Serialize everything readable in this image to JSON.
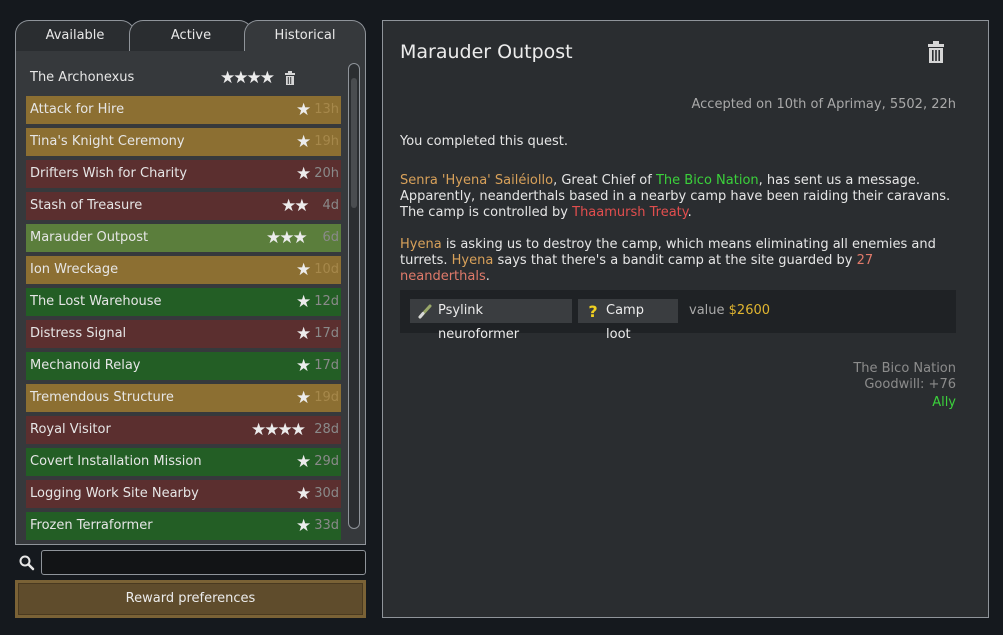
{
  "tabs": [
    {
      "label": "Available"
    },
    {
      "label": "Active"
    },
    {
      "label": "Historical"
    }
  ],
  "selected_tab": "Historical",
  "quests": [
    {
      "name": "The Archonexus",
      "stars": 4,
      "time": "",
      "color": "plain",
      "trash": true
    },
    {
      "name": "Attack for Hire",
      "stars": 1,
      "time": "13h",
      "color": "orange"
    },
    {
      "name": "Tina's Knight Ceremony",
      "stars": 1,
      "time": "19h",
      "color": "orange"
    },
    {
      "name": "Drifters Wish for Charity",
      "stars": 1,
      "time": "20h",
      "color": "red"
    },
    {
      "name": "Stash of Treasure",
      "stars": 2,
      "time": "4d",
      "color": "red"
    },
    {
      "name": "Marauder Outpost",
      "stars": 3,
      "time": "6d",
      "color": "selected"
    },
    {
      "name": "Ion Wreckage",
      "stars": 1,
      "time": "10d",
      "color": "orange"
    },
    {
      "name": "The Lost Warehouse",
      "stars": 1,
      "time": "12d",
      "color": "green"
    },
    {
      "name": "Distress Signal",
      "stars": 1,
      "time": "17d",
      "color": "red"
    },
    {
      "name": "Mechanoid Relay",
      "stars": 1,
      "time": "17d",
      "color": "green"
    },
    {
      "name": "Tremendous Structure",
      "stars": 1,
      "time": "19d",
      "color": "orange"
    },
    {
      "name": "Royal Visitor",
      "stars": 4,
      "time": "28d",
      "color": "red"
    },
    {
      "name": "Covert Installation Mission",
      "stars": 1,
      "time": "29d",
      "color": "green"
    },
    {
      "name": "Logging Work Site Nearby",
      "stars": 1,
      "time": "30d",
      "color": "red"
    },
    {
      "name": "Frozen Terraformer",
      "stars": 1,
      "time": "33d",
      "color": "green"
    }
  ],
  "search": {
    "value": "",
    "placeholder": ""
  },
  "reward_preferences_label": "Reward preferences",
  "detail": {
    "title": "Marauder Outpost",
    "accepted": "Accepted on 10th of Aprimay, 5502, 22h",
    "completed": "You completed this quest.",
    "para1": {
      "giver": "Senra 'Hyena' Sailéiollo",
      "t1": ", Great Chief of ",
      "faction": "The Bico Nation",
      "t2": ", has sent us a message. Apparently, neanderthals based in a nearby camp have been raiding their caravans. The camp is controlled by ",
      "controller": "Thaamursh Treaty",
      "t3": "."
    },
    "para2": {
      "name1": "Hyena",
      "t1": " is asking us to destroy the camp, which means eliminating all enemies and turrets. ",
      "name2": "Hyena",
      "t2": " says that there's a bandit camp at the site guarded by ",
      "enemies": "27 neanderthals",
      "t3": "."
    },
    "rewards": [
      {
        "label": "Psylink neuroformer",
        "icon": "psylink-icon"
      },
      {
        "label": "Camp loot",
        "icon": "question-mark-icon"
      }
    ],
    "value_label": "value",
    "value_amount": "$2600",
    "faction_name": "The Bico Nation",
    "goodwill": "Goodwill: +76",
    "relation": "Ally"
  },
  "colors": {
    "orange": "#8c6f32",
    "red": "#5b2f2f",
    "green": "#235e25",
    "selected": "#5b7e3c",
    "text_orange": "#d8a15a",
    "text_green": "#3bd13b",
    "text_red": "#e24e4e",
    "value_gold": "#e0b530"
  }
}
